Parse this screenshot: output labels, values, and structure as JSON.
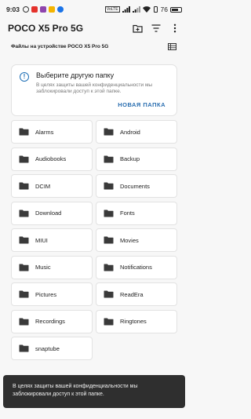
{
  "status_bar": {
    "time": "9:03",
    "battery_text": "76",
    "battery_level": 0.76,
    "network_badge": "VoLTE",
    "icon_colors": [
      "#e4312b",
      "#1a73e8",
      "#f4b400",
      "#8e44ad"
    ]
  },
  "app_bar": {
    "title": "POCO X5 Pro 5G",
    "new_folder_icon": "create-folder-icon",
    "sort_icon": "sort-icon"
  },
  "location": {
    "subtitle": "Файлы на устройстве POCO X5 Pro 5G",
    "view_icon": "list-view-icon"
  },
  "info_card": {
    "title": "Выберите другую папку",
    "text": "В целях защиты вашей конфиденциальности мы заблокировали доступ к этой папке.",
    "action": "НОВАЯ ПАПКА",
    "accent": "#2a6eb0"
  },
  "folders": [
    "Alarms",
    "Android",
    "Audiobooks",
    "Backup",
    "DCIM",
    "Documents",
    "Download",
    "Fonts",
    "MIUI",
    "Movies",
    "Music",
    "Notifications",
    "Pictures",
    "ReadEra",
    "Recordings",
    "Ringtones",
    "snaptube"
  ],
  "snackbar": {
    "text": "В целях защиты вашей конфиденциальности мы заблокировали доступ к этой папке."
  }
}
